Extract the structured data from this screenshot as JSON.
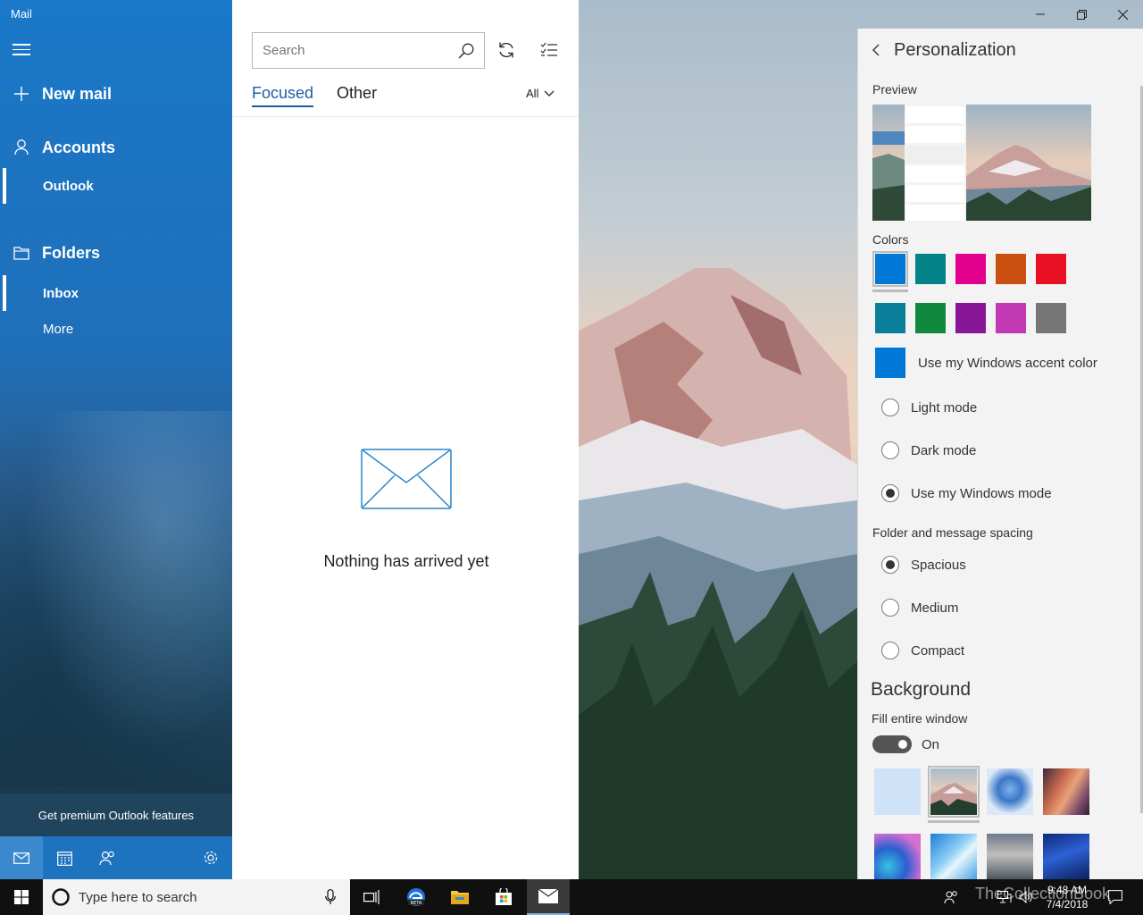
{
  "app": {
    "title": "Mail"
  },
  "nav": {
    "new_mail": "New mail",
    "accounts": "Accounts",
    "account_name": "Outlook",
    "folders": "Folders",
    "inbox": "Inbox",
    "more": "More",
    "premium": "Get premium Outlook features"
  },
  "list": {
    "search_placeholder": "Search",
    "tabs": [
      "Focused",
      "Other"
    ],
    "filter": "All",
    "empty": "Nothing has arrived yet"
  },
  "personalization": {
    "title": "Personalization",
    "preview_label": "Preview",
    "colors_label": "Colors",
    "colors": [
      "#0078d7",
      "#038387",
      "#e3008c",
      "#ca5010",
      "#e81123",
      "#0b7f9a",
      "#10893e",
      "#881798",
      "#c239b3",
      "#767676"
    ],
    "selected_color": "#0078d7",
    "accent_label": "Use my Windows accent color",
    "accent_color": "#0078d7",
    "mode_options": [
      "Light mode",
      "Dark mode",
      "Use my Windows mode"
    ],
    "mode_selected": "Use my Windows mode",
    "spacing_label": "Folder and message spacing",
    "spacing_options": [
      "Spacious",
      "Medium",
      "Compact"
    ],
    "spacing_selected": "Spacious",
    "background_label": "Background",
    "fill_label": "Fill entire window",
    "fill_state": "On"
  },
  "taskbar": {
    "search_placeholder": "Type here to search",
    "time": "9:48 AM",
    "date": "7/4/2018",
    "watermark": "TheCollectionBook"
  }
}
